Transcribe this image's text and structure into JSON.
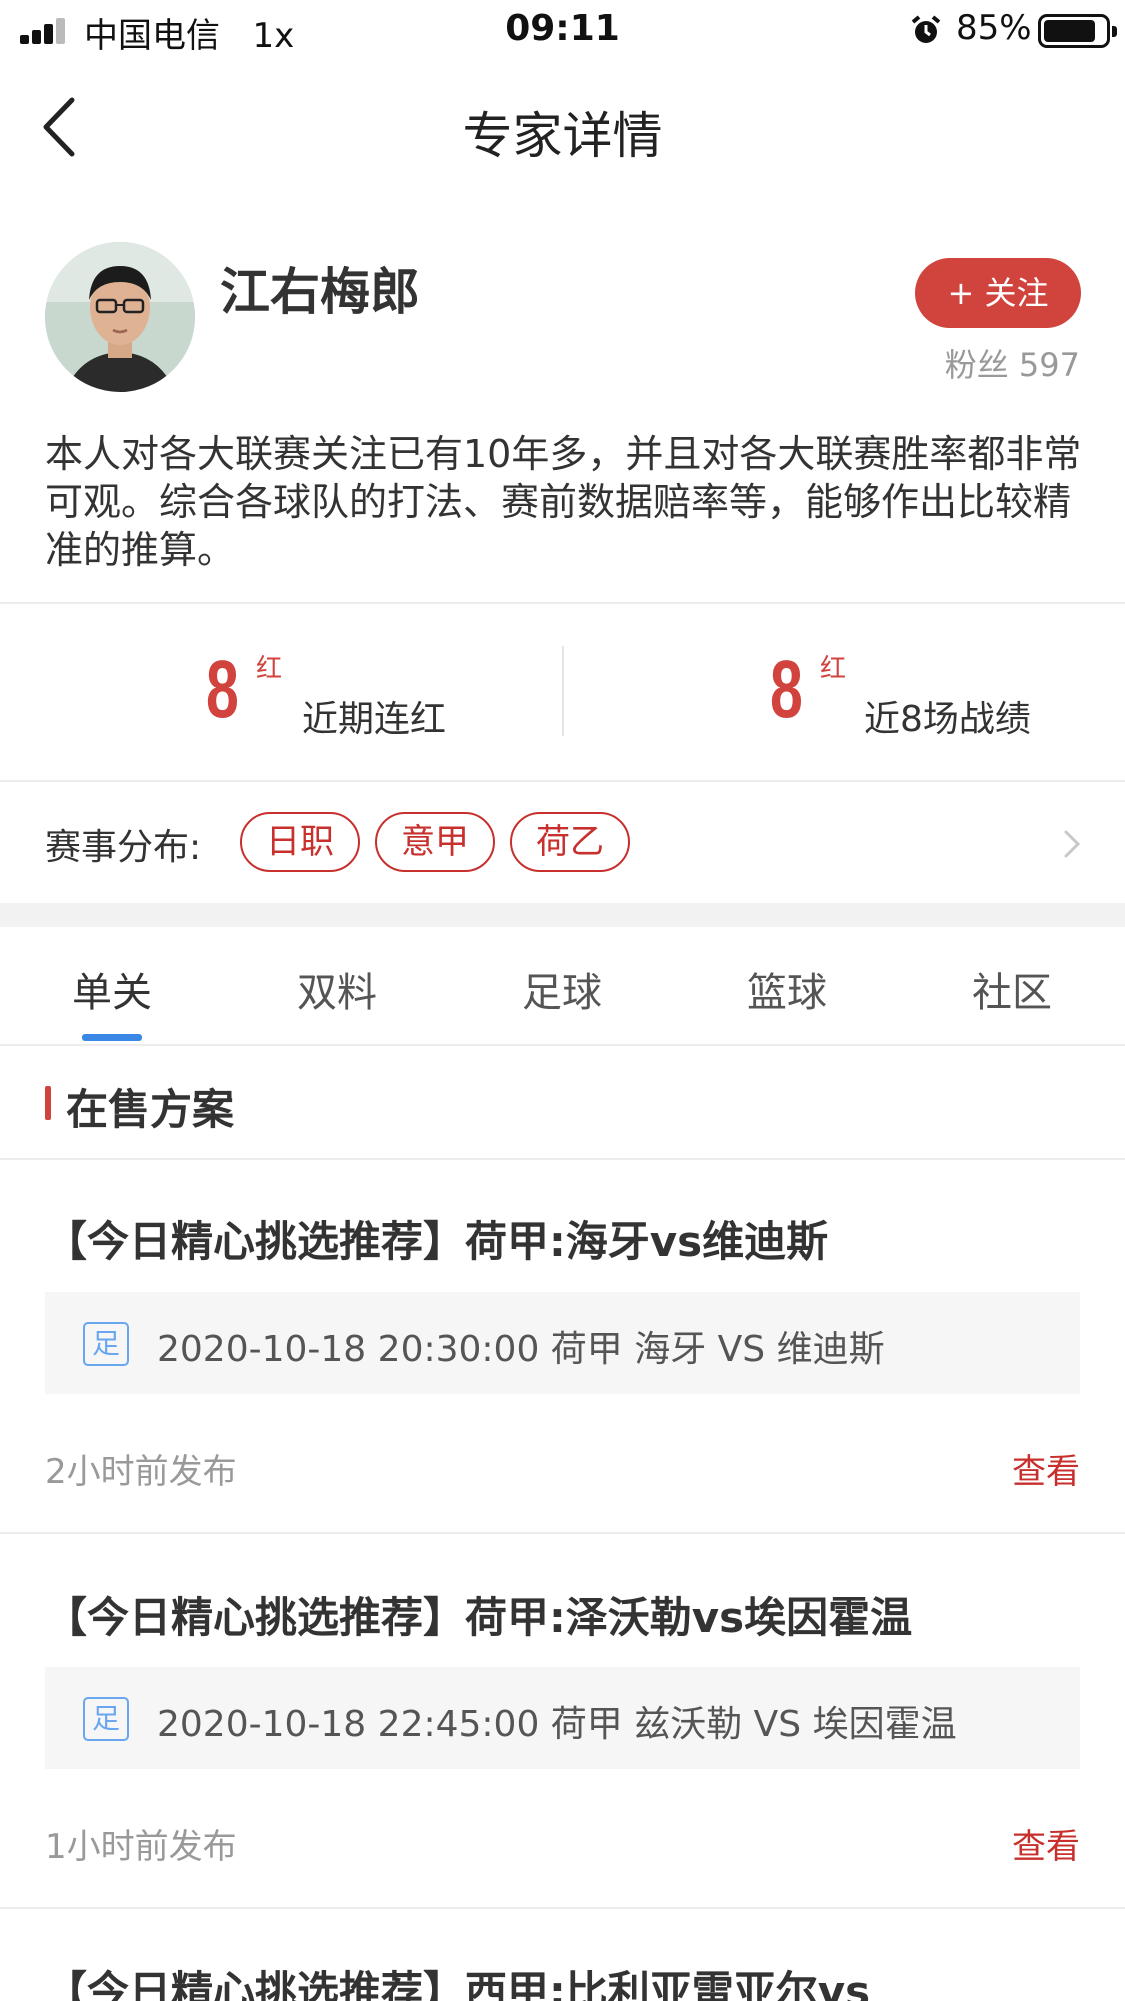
{
  "status_bar": {
    "carrier": "中国电信",
    "network": "1x",
    "time": "09:11",
    "battery_percent": "85%",
    "battery_level": 0.85
  },
  "nav": {
    "title": "专家详情",
    "back_icon": "chevron-left-icon"
  },
  "expert": {
    "name": "江右梅郎",
    "follow_label": "+ 关注",
    "fans_label": "粉丝",
    "fans_count": "597",
    "bio": "本人对各大联赛关注已有10年多，并且对各大联赛胜率都非常可观。综合各球队的打法、赛前数据赔率等，能够作出比较精准的推算。"
  },
  "stats": [
    {
      "value": "8",
      "unit": "红",
      "label": "近期连红"
    },
    {
      "value": "8",
      "unit": "红",
      "label": "近8场战绩"
    }
  ],
  "events": {
    "label": "赛事分布:",
    "leagues": [
      "日职",
      "意甲",
      "荷乙"
    ]
  },
  "tabs": [
    {
      "label": "单关",
      "active": true
    },
    {
      "label": "双料",
      "active": false
    },
    {
      "label": "足球",
      "active": false
    },
    {
      "label": "篮球",
      "active": false
    },
    {
      "label": "社区",
      "active": false
    }
  ],
  "section_title": "在售方案",
  "plans": [
    {
      "title": "【今日精心挑选推荐】荷甲:海牙vs维迪斯",
      "sport_tag": "足",
      "match": "2020-10-18 20:30:00 荷甲 海牙 VS 维迪斯",
      "published": "2小时前发布",
      "view_label": "查看"
    },
    {
      "title": "【今日精心挑选推荐】荷甲:泽沃勒vs埃因霍温",
      "sport_tag": "足",
      "match": "2020-10-18 22:45:00 荷甲 兹沃勒 VS 埃因霍温",
      "published": "1小时前发布",
      "view_label": "查看"
    },
    {
      "title": "【今日精心挑选推荐】西甲:比利亚雷亚尔vs"
    }
  ],
  "colors": {
    "accent_red": "#d1433d",
    "tab_indicator": "#3a87e5",
    "sport_tag_blue": "#6aa6ef"
  }
}
